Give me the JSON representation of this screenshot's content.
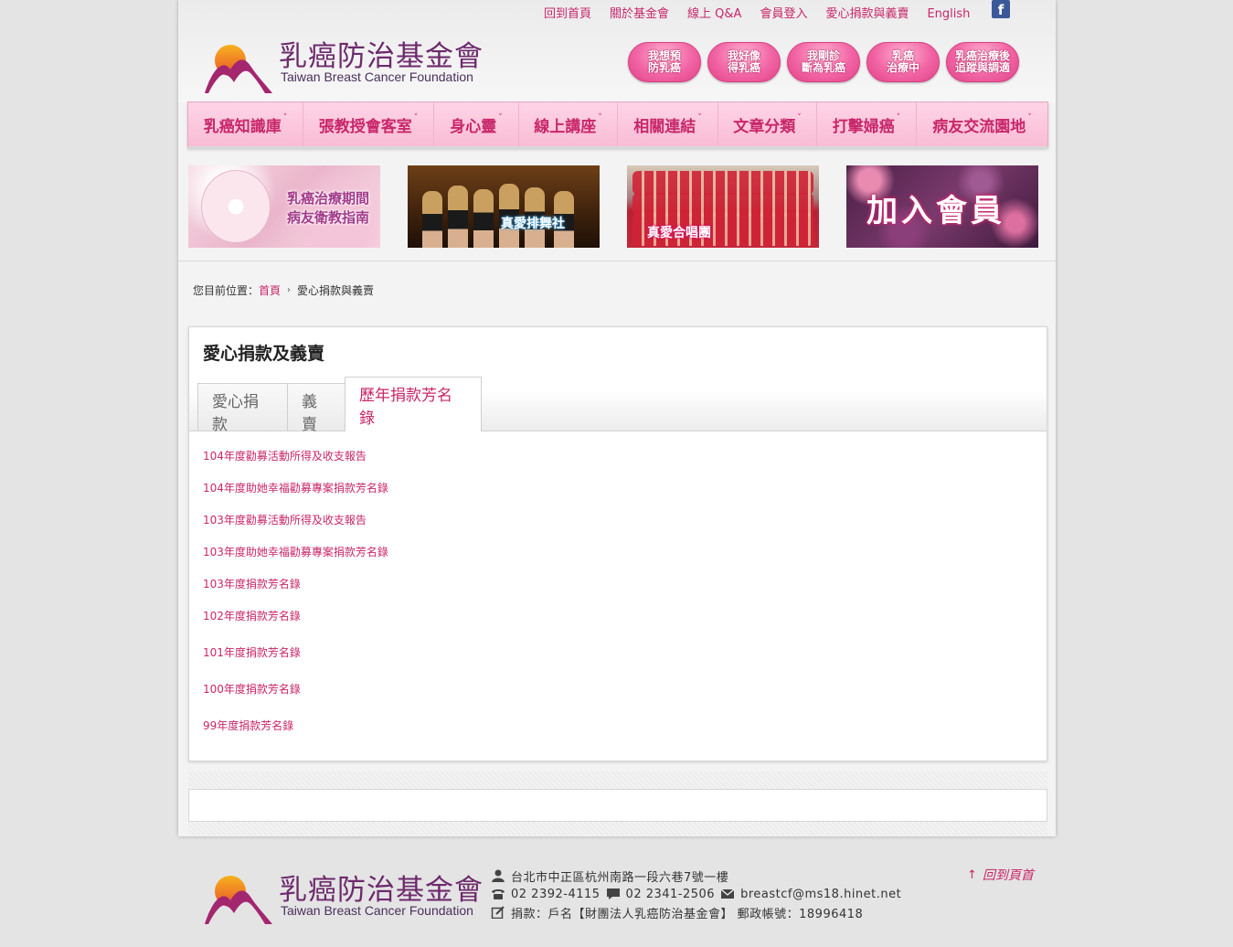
{
  "top_links": [
    "回到首頁",
    "關於基金會",
    "線上 Q&A",
    "會員登入",
    "愛心捐款與義賣",
    "English"
  ],
  "facebook_icon": "f",
  "logo": {
    "zh": "乳癌防治基金會",
    "en": "Taiwan Breast Cancer Foundation"
  },
  "circle_buttons": [
    "我想預\n防乳癌",
    "我好像\n得乳癌",
    "我剛診\n斷為乳癌",
    "乳癌\n治療中",
    "乳癌治療後\n追蹤與調適"
  ],
  "nav": [
    "乳癌知識庫",
    "張教授會客室",
    "身心靈",
    "線上講座",
    "相關連結",
    "文章分類",
    "打擊婦癌",
    "病友交流園地"
  ],
  "banners": {
    "b1": "乳癌治療期間\n病友衛教指南",
    "b2": "真愛排舞社",
    "b3": "真愛合唱團",
    "b4": "加入會員"
  },
  "breadcrumb": {
    "prefix": "您目前位置：",
    "home": "首頁",
    "current": "愛心捐款與義賣"
  },
  "content": {
    "title": "愛心捐款及義賣",
    "tabs": [
      {
        "label": "愛心捐款",
        "active": false
      },
      {
        "label": "義賣",
        "active": false
      },
      {
        "label": "歷年捐款芳名錄",
        "active": true
      }
    ],
    "documents": [
      "104年度勸募活動所得及收支報告",
      "104年度助她幸福勸募專案捐款芳名錄",
      "103年度勸募活動所得及收支報告",
      "103年度助她幸福勸募專案捐款芳名錄",
      "103年度捐款芳名錄",
      "102年度捐款芳名錄",
      "101年度捐款芳名錄",
      "100年度捐款芳名錄",
      "99年度捐款芳名錄"
    ]
  },
  "footer": {
    "address": "台北市中正區杭州南路一段六巷7號一樓",
    "phone": "02 2392-4115",
    "fax": "02 2341-2506",
    "email": "breastcf@ms18.hinet.net",
    "donation": "捐款：戶名【財團法人乳癌防治基金會】 郵政帳號：18996418",
    "back_to_top": "回到頁首"
  },
  "colors": {
    "accent": "#c8276a",
    "logo_purple": "#6d2a6c",
    "nav_bg": "#fbc7dc"
  }
}
